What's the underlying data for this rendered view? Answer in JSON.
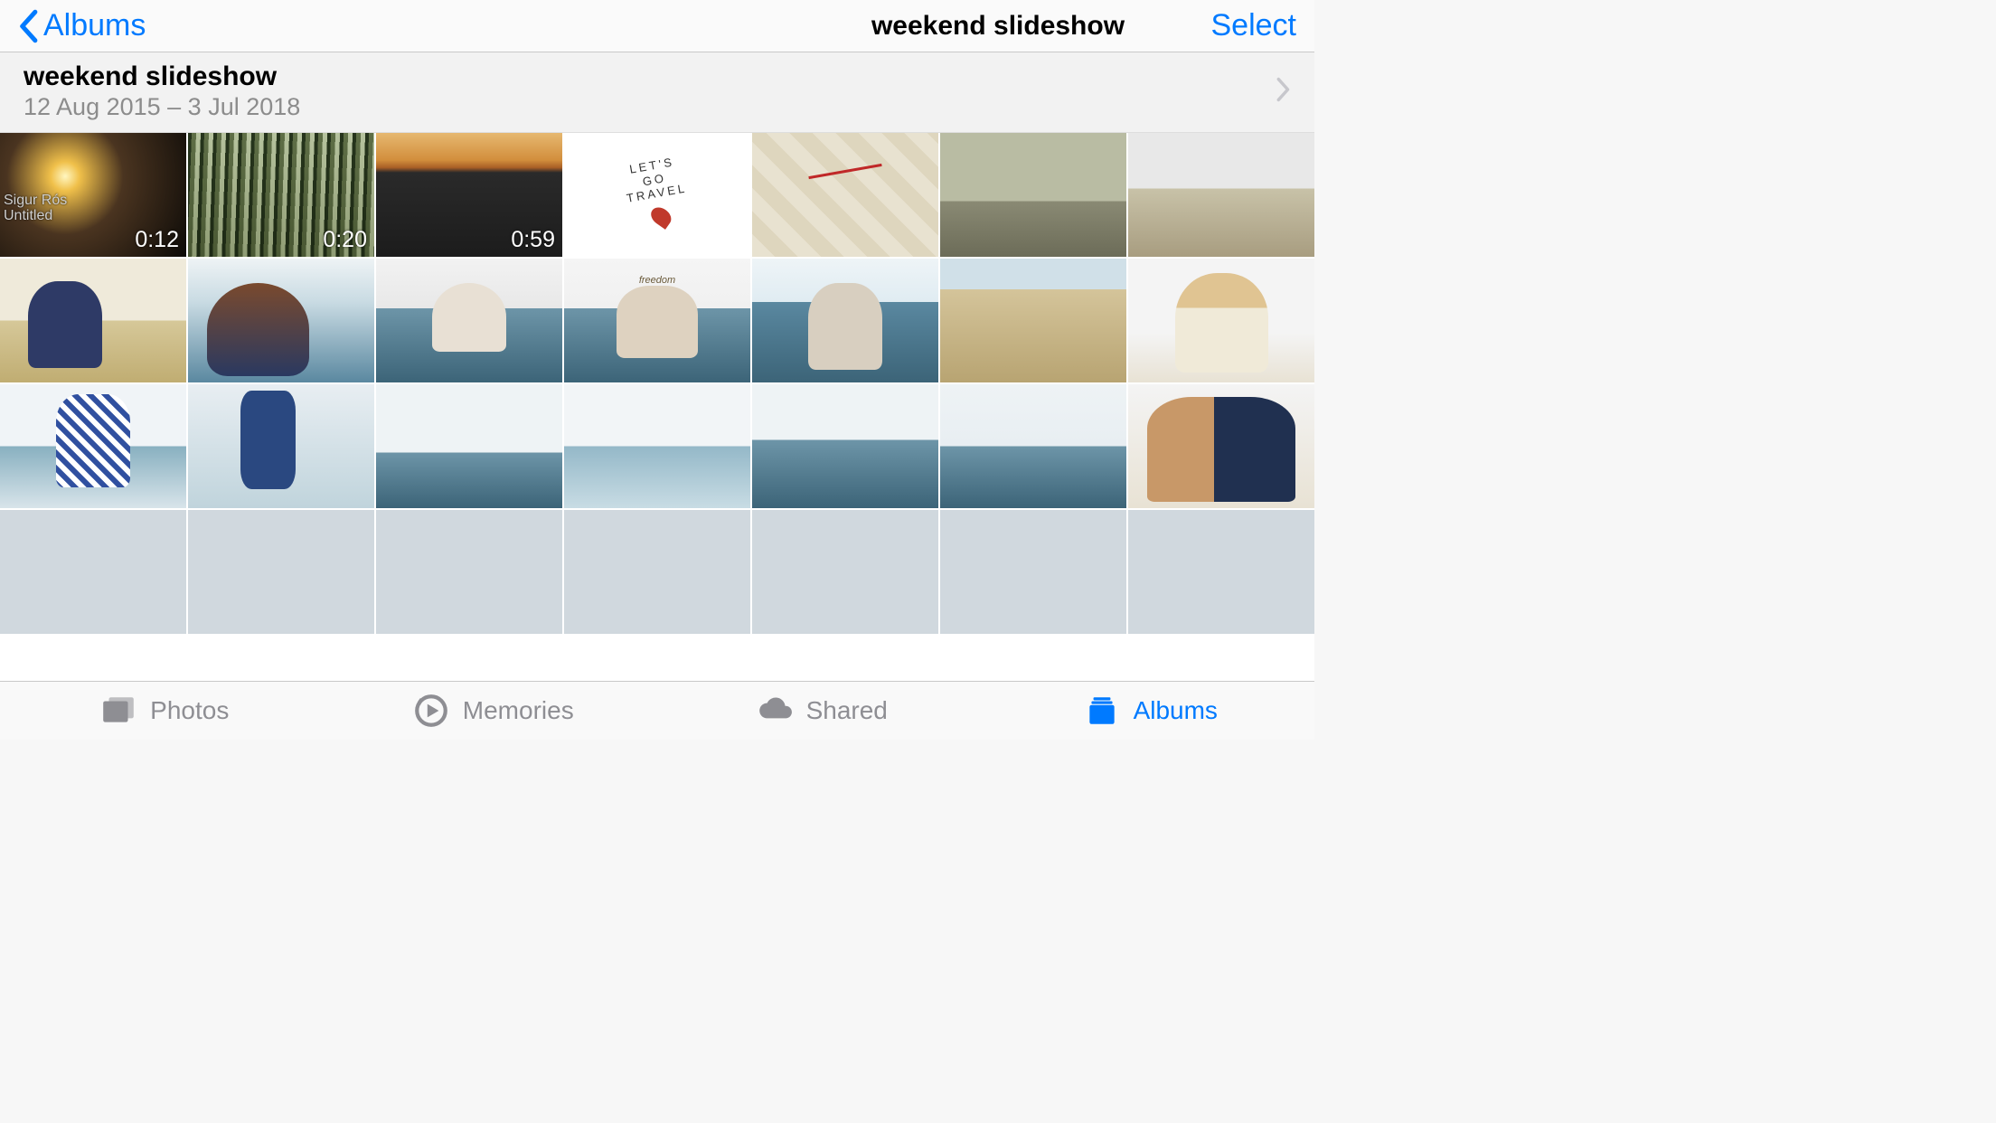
{
  "nav": {
    "back_label": "Albums",
    "title": "weekend slideshow",
    "select_label": "Select"
  },
  "header": {
    "title": "weekend slideshow",
    "date_range": "12 Aug 2015 – 3 Jul 2018"
  },
  "thumbs": {
    "video1": {
      "duration": "0:12",
      "caption_line1": "Sigur Rós",
      "caption_line2": "Untitled"
    },
    "video2": {
      "duration": "0:20"
    },
    "video3": {
      "duration": "0:59"
    },
    "travel_note": {
      "line1": "LET'S",
      "line2": "GO",
      "line3": "TRAVEL"
    },
    "freedom_banner": "freedom"
  },
  "tabs": {
    "photos": "Photos",
    "memories": "Memories",
    "shared": "Shared",
    "albums": "Albums"
  }
}
